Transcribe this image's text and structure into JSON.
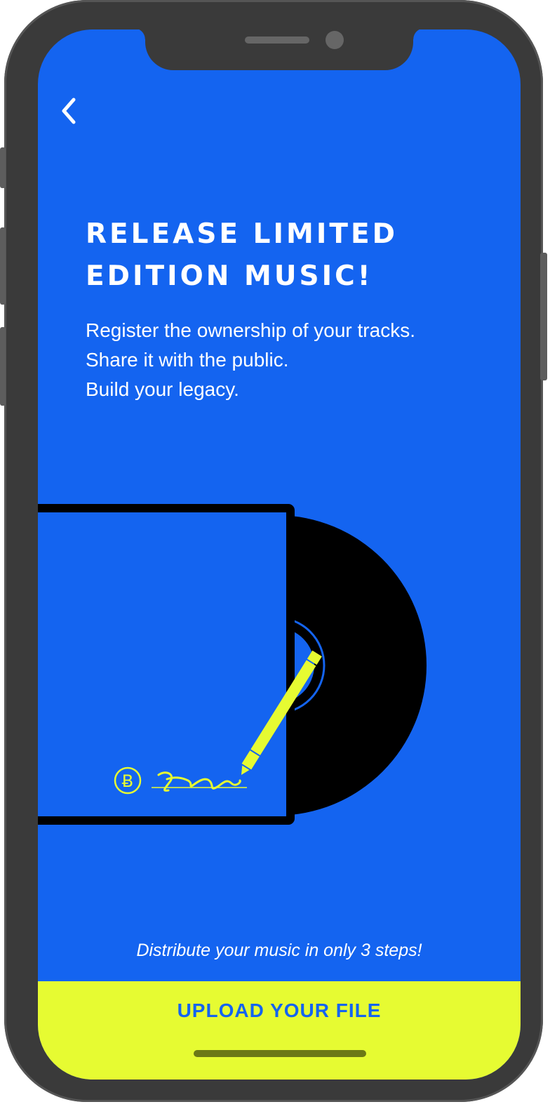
{
  "header": {
    "back_icon": "chevron-left-icon"
  },
  "hero": {
    "title_line1": "RELEASE LIMITED",
    "title_line2": "EDITION MUSIC!",
    "body_lines": [
      "Register the ownership of your tracks.",
      "Share it with the public.",
      "Build your legacy."
    ]
  },
  "illustration": {
    "icons": [
      "vinyl-record-icon",
      "album-sleeve-icon",
      "coin-icon",
      "signature-icon",
      "pen-icon"
    ],
    "coin_symbol": "Ƀ"
  },
  "footer": {
    "tagline": "Distribute your music in only 3 steps!",
    "cta_label": "UPLOAD YOUR FILE"
  },
  "colors": {
    "background": "#1464f0",
    "accent": "#e6fb32",
    "text": "#ffffff",
    "frame": "#3a3a3a"
  }
}
